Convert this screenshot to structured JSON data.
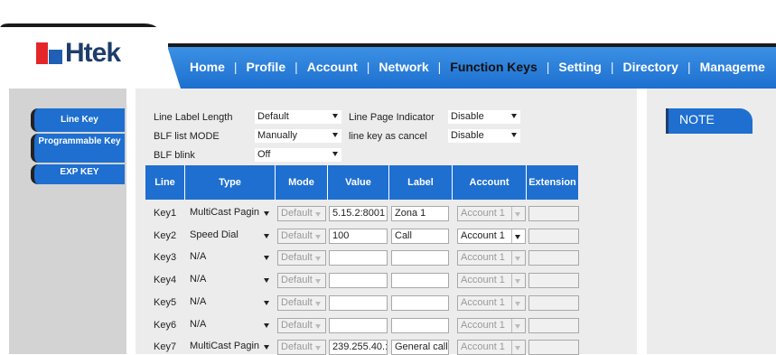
{
  "brand": {
    "logo_text": "Htek"
  },
  "nav": {
    "items": [
      "Home",
      "Profile",
      "Account",
      "Network",
      "Function Keys",
      "Setting",
      "Directory",
      "Manageme"
    ],
    "active": "Function Keys"
  },
  "sidebar": {
    "items": [
      {
        "label": "Line Key"
      },
      {
        "label": "Programmable Key"
      },
      {
        "label": "EXP KEY"
      }
    ]
  },
  "settings": {
    "line_label_length": {
      "label": "Line Label Length",
      "value": "Default"
    },
    "line_page_indicator": {
      "label": "Line Page Indicator",
      "value": "Disable"
    },
    "blf_list_mode": {
      "label": "BLF list MODE",
      "value": "Manually"
    },
    "line_key_as_cancel": {
      "label": "line key as cancel",
      "value": "Disable"
    },
    "blf_blink": {
      "label": "BLF blink",
      "value": "Off"
    }
  },
  "table": {
    "headers": [
      "Line",
      "Type",
      "Mode",
      "Value",
      "Label",
      "Account",
      "Extension"
    ],
    "rows": [
      {
        "line": "Key1",
        "type": "MultiCast Pagin",
        "mode": "Default",
        "value": "5.15.2:8001",
        "label": "Zona 1",
        "account": "Account 1",
        "extension": "",
        "account_enabled": false
      },
      {
        "line": "Key2",
        "type": "Speed Dial",
        "mode": "Default",
        "value": "100",
        "label": "Call",
        "account": "Account 1",
        "extension": "",
        "account_enabled": true
      },
      {
        "line": "Key3",
        "type": "N/A",
        "mode": "Default",
        "value": "",
        "label": "",
        "account": "Account 1",
        "extension": "",
        "account_enabled": false
      },
      {
        "line": "Key4",
        "type": "N/A",
        "mode": "Default",
        "value": "",
        "label": "",
        "account": "Account 1",
        "extension": "",
        "account_enabled": false
      },
      {
        "line": "Key5",
        "type": "N/A",
        "mode": "Default",
        "value": "",
        "label": "",
        "account": "Account 1",
        "extension": "",
        "account_enabled": false
      },
      {
        "line": "Key6",
        "type": "N/A",
        "mode": "Default",
        "value": "",
        "label": "",
        "account": "Account 1",
        "extension": "",
        "account_enabled": false
      },
      {
        "line": "Key7",
        "type": "MultiCast Pagin",
        "mode": "Default",
        "value": "239.255.40.:",
        "label": "General call",
        "account": "Account 1",
        "extension": "",
        "account_enabled": false
      }
    ]
  },
  "note": {
    "title": "NOTE"
  },
  "colors": {
    "accent": "#1e6fd0",
    "header_blue": "#2a7fd9",
    "panel": "#ececec"
  }
}
